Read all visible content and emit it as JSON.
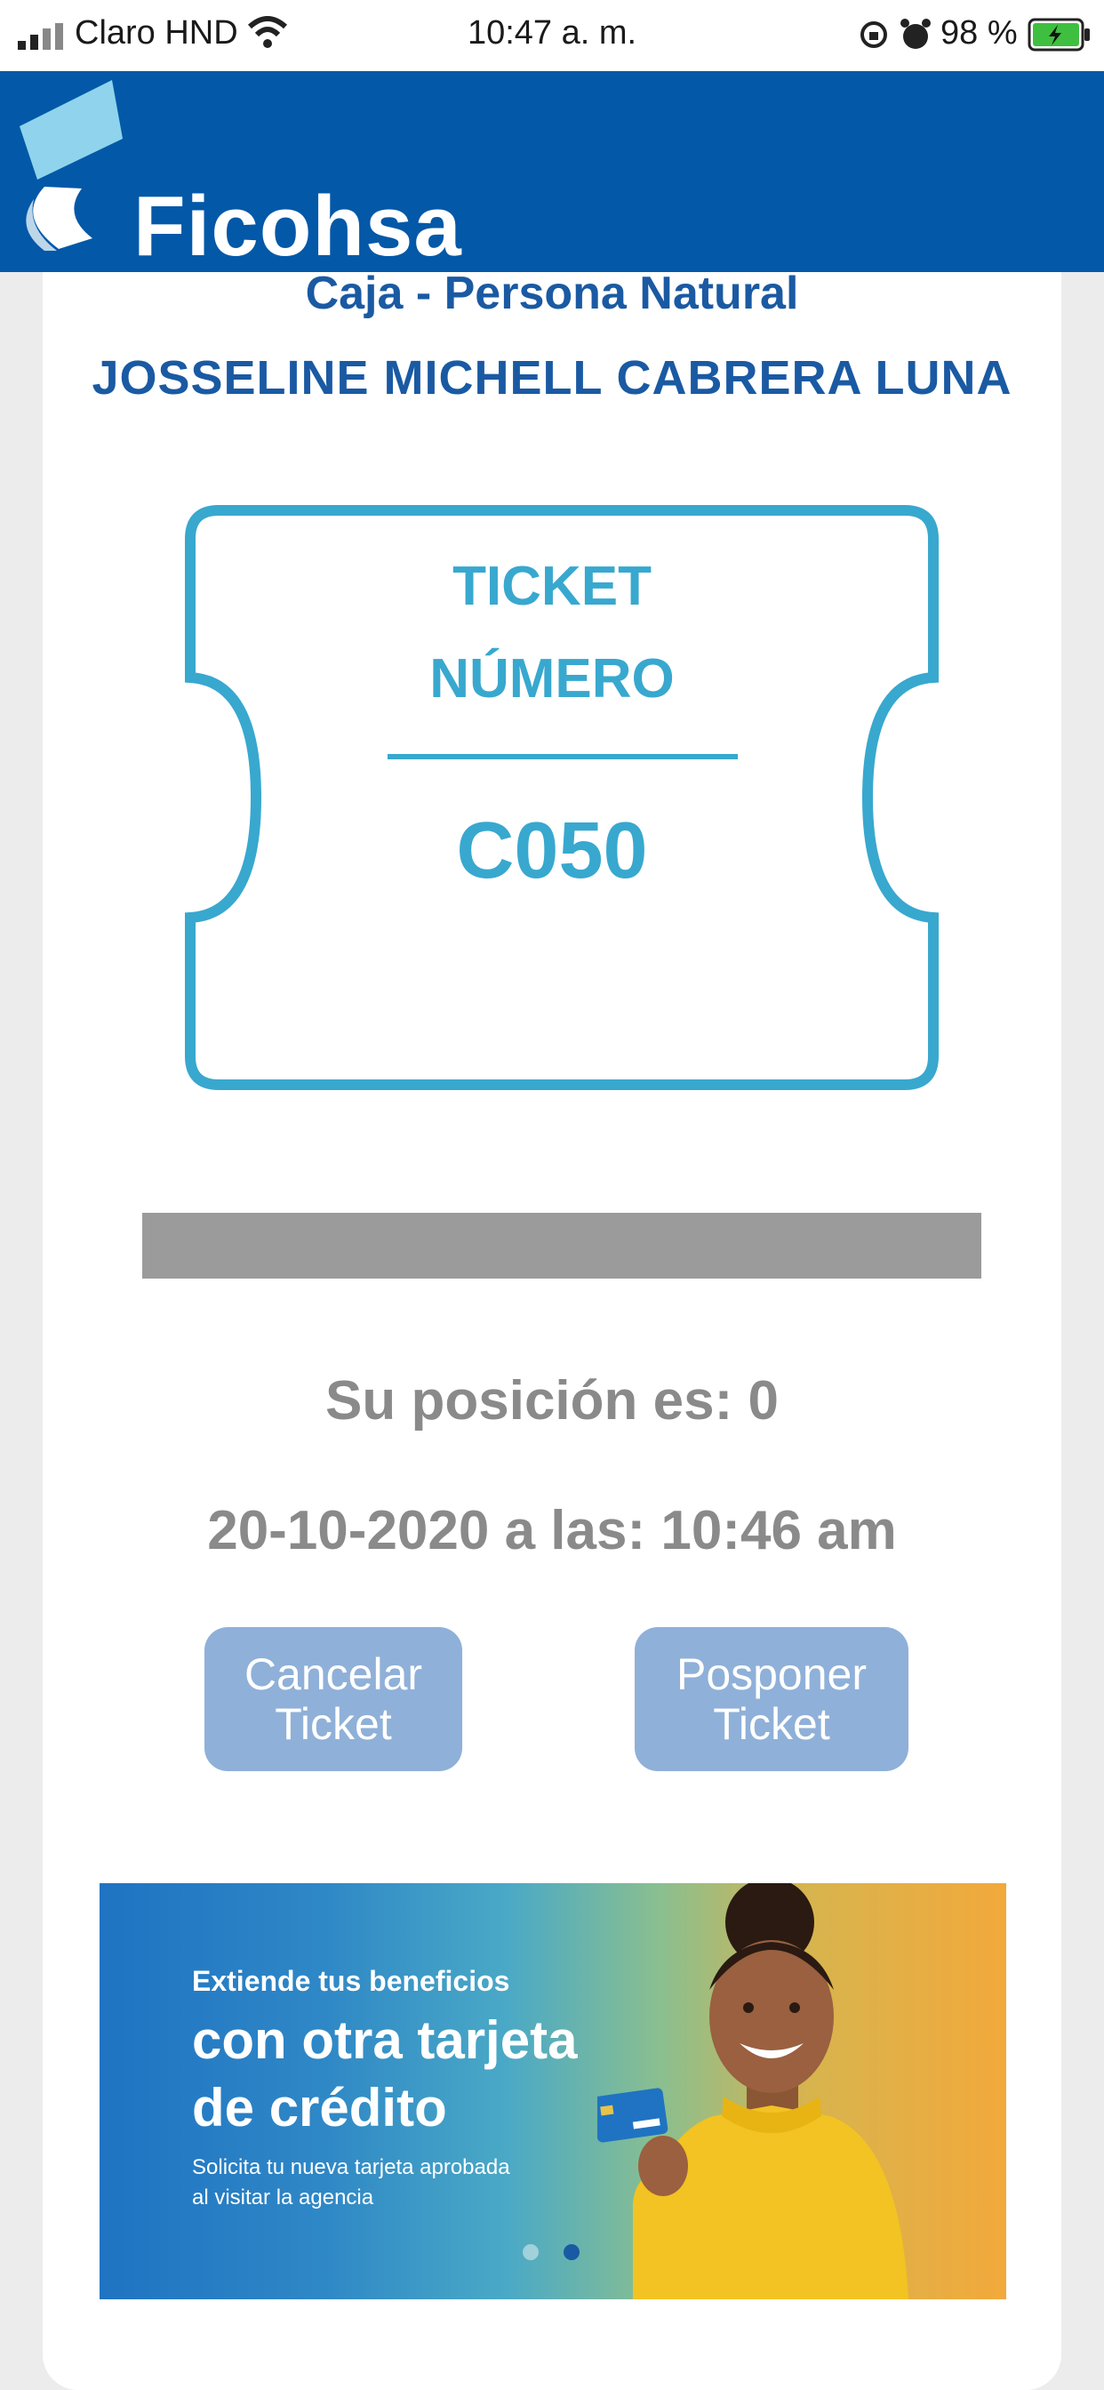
{
  "status_bar": {
    "carrier": "Claro HND",
    "time": "10:47 a. m.",
    "battery": "98 %"
  },
  "header": {
    "brand": "Ficohsa"
  },
  "ticket_info": {
    "service": "Caja - Persona Natural",
    "customer_name": "JOSSELINE MICHELL CABRERA LUNA",
    "ticket_label_line1": "TICKET",
    "ticket_label_line2": "NÚMERO",
    "ticket_number": "C050"
  },
  "queue": {
    "progress_fraction": 1.0,
    "position_text": "Su posición es: 0",
    "datetime_text": "20-10-2020 a las: 10:46 am"
  },
  "actions": {
    "cancel_line1": "Cancelar",
    "cancel_line2": "Ticket",
    "postpone_line1": "Posponer",
    "postpone_line2": "Ticket"
  },
  "promo": {
    "eyebrow": "Extiende tus beneficios",
    "headline_line1": "con otra tarjeta",
    "headline_line2": "de crédito",
    "subtext_line1": "Solicita tu nueva tarjeta aprobada",
    "subtext_line2": "al visitar la agencia",
    "active_slide": 2,
    "total_slides": 2
  },
  "colors": {
    "brand_blue": "#0358a8",
    "ticket_accent": "#38a8cf",
    "button_bg": "#8fb0d8",
    "text_gray": "#8a8a8a"
  },
  "icons": [
    "signal-icon",
    "wifi-icon",
    "orientation-lock-icon",
    "alarm-icon",
    "battery-icon",
    "ficohsa-logo-icon",
    "ticket-outline-icon"
  ]
}
